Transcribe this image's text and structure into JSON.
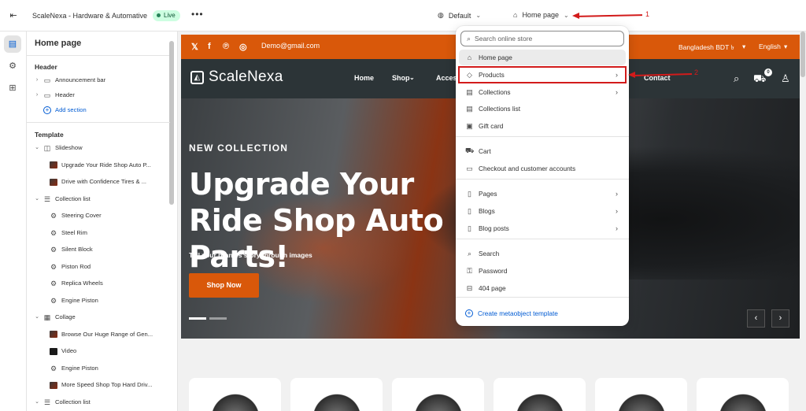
{
  "topbar": {
    "store_name": "ScaleNexa - Hardware & Automative",
    "status": "Live",
    "more": "•••",
    "theme_label": "Default",
    "page_selector": "Home page"
  },
  "annotations": {
    "one": "1",
    "two": "2"
  },
  "sidebar": {
    "title": "Home page",
    "header_group": "Header",
    "header_items": [
      {
        "label": "Announcement bar",
        "icon": "section-icon"
      },
      {
        "label": "Header",
        "icon": "section-icon"
      }
    ],
    "add_section": "Add section",
    "template_group": "Template",
    "rows": [
      {
        "label": "Slideshow",
        "level": 0,
        "icon": "slideshow-icon"
      },
      {
        "label": "Upgrade Your Ride Shop Auto P...",
        "level": 1,
        "icon": "thumb"
      },
      {
        "label": "Drive with Confidence Tires & ...",
        "level": 1,
        "icon": "thumb"
      },
      {
        "label": "Collection list",
        "level": 0,
        "icon": "list-icon"
      },
      {
        "label": "Steering Cover",
        "level": 1,
        "icon": "item-icon"
      },
      {
        "label": "Steel Rim",
        "level": 1,
        "icon": "item-icon"
      },
      {
        "label": "Silent Block",
        "level": 1,
        "icon": "item-icon"
      },
      {
        "label": "Piston Rod",
        "level": 1,
        "icon": "item-icon"
      },
      {
        "label": "Replica Wheels",
        "level": 1,
        "icon": "item-icon"
      },
      {
        "label": "Engine Piston",
        "level": 1,
        "icon": "item-icon"
      },
      {
        "label": "Collage",
        "level": 0,
        "icon": "collage-icon"
      },
      {
        "label": "Browse Our Huge Range of Gen...",
        "level": 1,
        "icon": "thumb"
      },
      {
        "label": "Video",
        "level": 1,
        "icon": "thumb-dark"
      },
      {
        "label": "Engine Piston",
        "level": 1,
        "icon": "item-icon"
      },
      {
        "label": "More Speed Shop Top Hard Driv...",
        "level": 1,
        "icon": "thumb"
      },
      {
        "label": "Collection list",
        "level": 0,
        "icon": "list-icon"
      }
    ]
  },
  "preview": {
    "announcement": {
      "email": "Demo@gmail.com",
      "currency": "Bangladesh BDT ৳",
      "language": "English"
    },
    "header": {
      "logo": "ScaleNexa",
      "nav": [
        "Home",
        "Shop",
        "Acces",
        "Contact"
      ]
    },
    "cart_count": "0",
    "hero": {
      "kicker": "NEW COLLECTION",
      "title": "Upgrade Your Ride Shop Auto Parts!",
      "subtitle": "Tell your brand's story through images",
      "button": "Shop Now"
    }
  },
  "dropdown": {
    "search_placeholder": "Search online store",
    "items": [
      {
        "label": "Home page",
        "icon": "home-icon",
        "selected": true
      },
      {
        "label": "Products",
        "icon": "tag-icon",
        "chevron": true
      },
      {
        "label": "Collections",
        "icon": "collection-icon",
        "chevron": true
      },
      {
        "label": "Collections list",
        "icon": "collection-list-icon"
      },
      {
        "label": "Gift card",
        "icon": "gift-card-icon"
      },
      {
        "label": "Cart",
        "icon": "cart-icon"
      },
      {
        "label": "Checkout and customer accounts",
        "icon": "checkout-icon"
      },
      {
        "label": "Pages",
        "icon": "page-icon",
        "chevron": true
      },
      {
        "label": "Blogs",
        "icon": "blog-icon",
        "chevron": true
      },
      {
        "label": "Blog posts",
        "icon": "blog-post-icon",
        "chevron": true
      },
      {
        "label": "Search",
        "icon": "search-icon"
      },
      {
        "label": "Password",
        "icon": "lock-icon"
      },
      {
        "label": "404 page",
        "icon": "404-icon"
      }
    ],
    "create_template": "Create metaobject template"
  },
  "colors": {
    "accent": "#d9580a",
    "header_bg": "#2c3437",
    "link": "#005bd3",
    "annotation": "#d21b1b"
  }
}
